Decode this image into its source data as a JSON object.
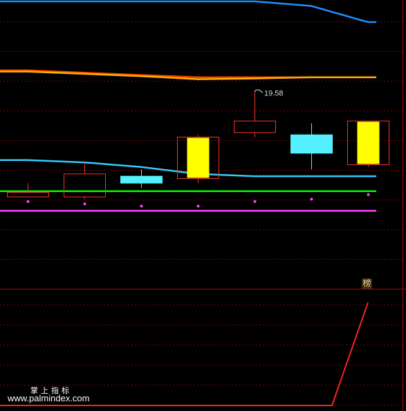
{
  "chart_data": [
    {
      "type": "candlestick",
      "panel": "main",
      "candles": [
        {
          "open": 15.2,
          "high": 15.6,
          "low": 15.0,
          "close": 15.0,
          "style": "red-hollow"
        },
        {
          "open": 15.0,
          "high": 16.5,
          "low": 14.9,
          "close": 16.0,
          "style": "red-hollow"
        },
        {
          "open": 15.9,
          "high": 16.2,
          "low": 15.4,
          "close": 15.6,
          "style": "cyan"
        },
        {
          "open": 15.8,
          "high": 17.7,
          "low": 15.6,
          "close": 17.6,
          "style": "yellow"
        },
        {
          "open": 17.8,
          "high": 19.58,
          "low": 17.6,
          "close": 18.3,
          "style": "red-hollow"
        },
        {
          "open": 17.7,
          "high": 18.2,
          "low": 16.2,
          "close": 16.9,
          "style": "cyan"
        },
        {
          "open": 16.4,
          "high": 18.3,
          "low": 16.3,
          "close": 18.3,
          "style": "yellow"
        }
      ],
      "ylim": [
        12.3,
        23.5
      ],
      "annotations": [
        {
          "text": "19.58",
          "candle_index": 4
        }
      ],
      "series": [
        {
          "values": [
            23.5,
            23.5,
            23.5,
            23.5,
            23.5,
            23.3,
            22.6
          ],
          "color": "#1e90ff"
        },
        {
          "values": [
            20.5,
            20.4,
            20.3,
            20.2,
            20.2,
            20.2,
            20.2
          ],
          "color": "#ff4000"
        },
        {
          "values": [
            20.45,
            20.35,
            20.25,
            20.12,
            20.15,
            20.2,
            20.2
          ],
          "color": "#ffb000"
        },
        {
          "values": [
            16.6,
            16.5,
            16.3,
            16.0,
            15.9,
            15.9,
            15.9
          ],
          "color": "#33ccff"
        },
        {
          "values": [
            15.25,
            15.25,
            15.25,
            15.25,
            15.25,
            15.25,
            15.25
          ],
          "color": "#00ff00"
        },
        {
          "values": [
            14.4,
            14.4,
            14.4,
            14.4,
            14.4,
            14.4,
            14.4
          ],
          "color": "#ff44ff"
        }
      ],
      "dots": {
        "values": [
          14.8,
          14.7,
          14.6,
          14.6,
          14.8,
          14.9,
          15.1
        ],
        "color": "#ff44ff"
      },
      "grid": true,
      "gridColor": "#8b0000"
    },
    {
      "type": "line",
      "panel": "indicator",
      "series": [
        {
          "values": [
            0,
            0,
            0,
            0,
            0,
            0,
            1
          ],
          "color": "#ff2020"
        }
      ],
      "ylim": [
        0,
        1
      ],
      "grid": true,
      "gridColor": "#8b0000"
    }
  ],
  "ui": {
    "badge_glyph": "榜",
    "watermark_cn": "掌上指标",
    "watermark_url": "www.palmindex.com"
  }
}
